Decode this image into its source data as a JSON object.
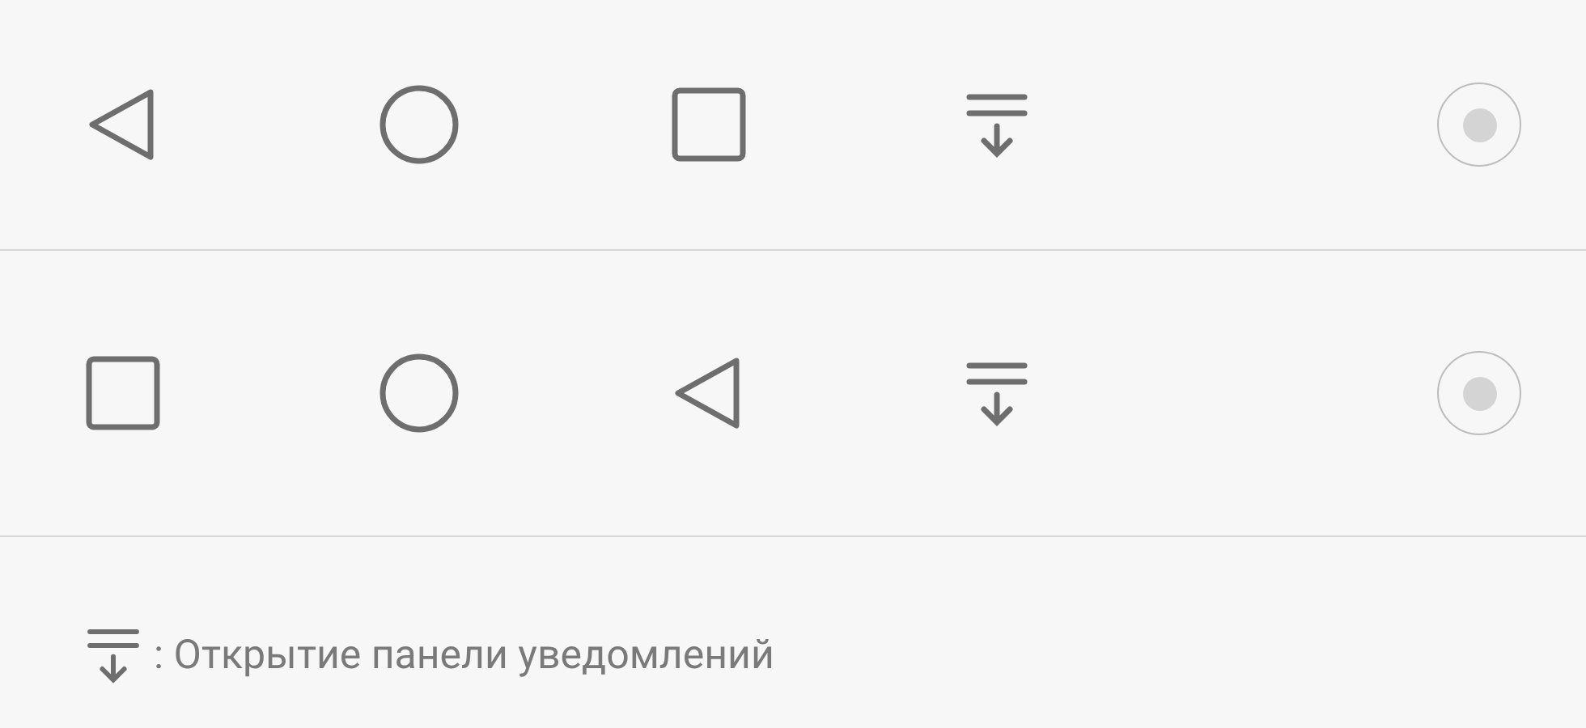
{
  "layouts": [
    {
      "buttons": [
        {
          "kind": "back"
        },
        {
          "kind": "home"
        },
        {
          "kind": "recent"
        },
        {
          "kind": "notifications"
        }
      ],
      "selected": false
    },
    {
      "buttons": [
        {
          "kind": "recent"
        },
        {
          "kind": "home"
        },
        {
          "kind": "back"
        },
        {
          "kind": "notifications"
        }
      ],
      "selected": false
    }
  ],
  "legend": {
    "icon": {
      "kind": "notifications"
    },
    "text": ": Открытие панели уведомлений"
  }
}
